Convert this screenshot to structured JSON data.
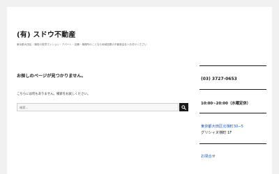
{
  "site": {
    "title": "(有) スドウ不動産",
    "description": "東京都大田区・蒲田の賃貸マンション・アパート・店舗・事務所のことなら地域密着の不動産会社へお任せください"
  },
  "main": {
    "heading": "お探しのページが見つかりません。",
    "message": "こちらには何もありません。検索をお試しください。",
    "search": {
      "placeholder": "検索...",
      "button_icon": "search-icon"
    }
  },
  "sidebar": {
    "phone": "(03) 3727-0653",
    "hours": "10:00~20:00（水曜定休）",
    "address_line1": "東京都大田区北嶺町30−5",
    "address_line2": "グリシィヌ嶺町 1F",
    "contact_link": "お問合せ"
  },
  "colors": {
    "background": "#f1f1f1",
    "page": "#ffffff",
    "text": "#1a1a1a",
    "link": "#1a56c2"
  }
}
